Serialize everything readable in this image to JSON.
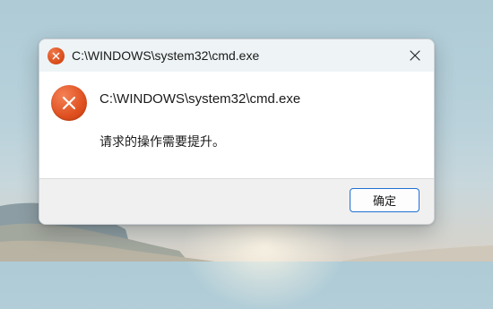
{
  "dialog": {
    "title": "C:\\WINDOWS\\system32\\cmd.exe",
    "message_heading": "C:\\WINDOWS\\system32\\cmd.exe",
    "message_body": "请求的操作需要提升。",
    "ok_label": "确定",
    "title_icon": "error-icon",
    "message_icon": "error-icon",
    "close_icon": "close-icon",
    "accent_color": "#df5020",
    "button_border_color": "#1f6fd1"
  }
}
